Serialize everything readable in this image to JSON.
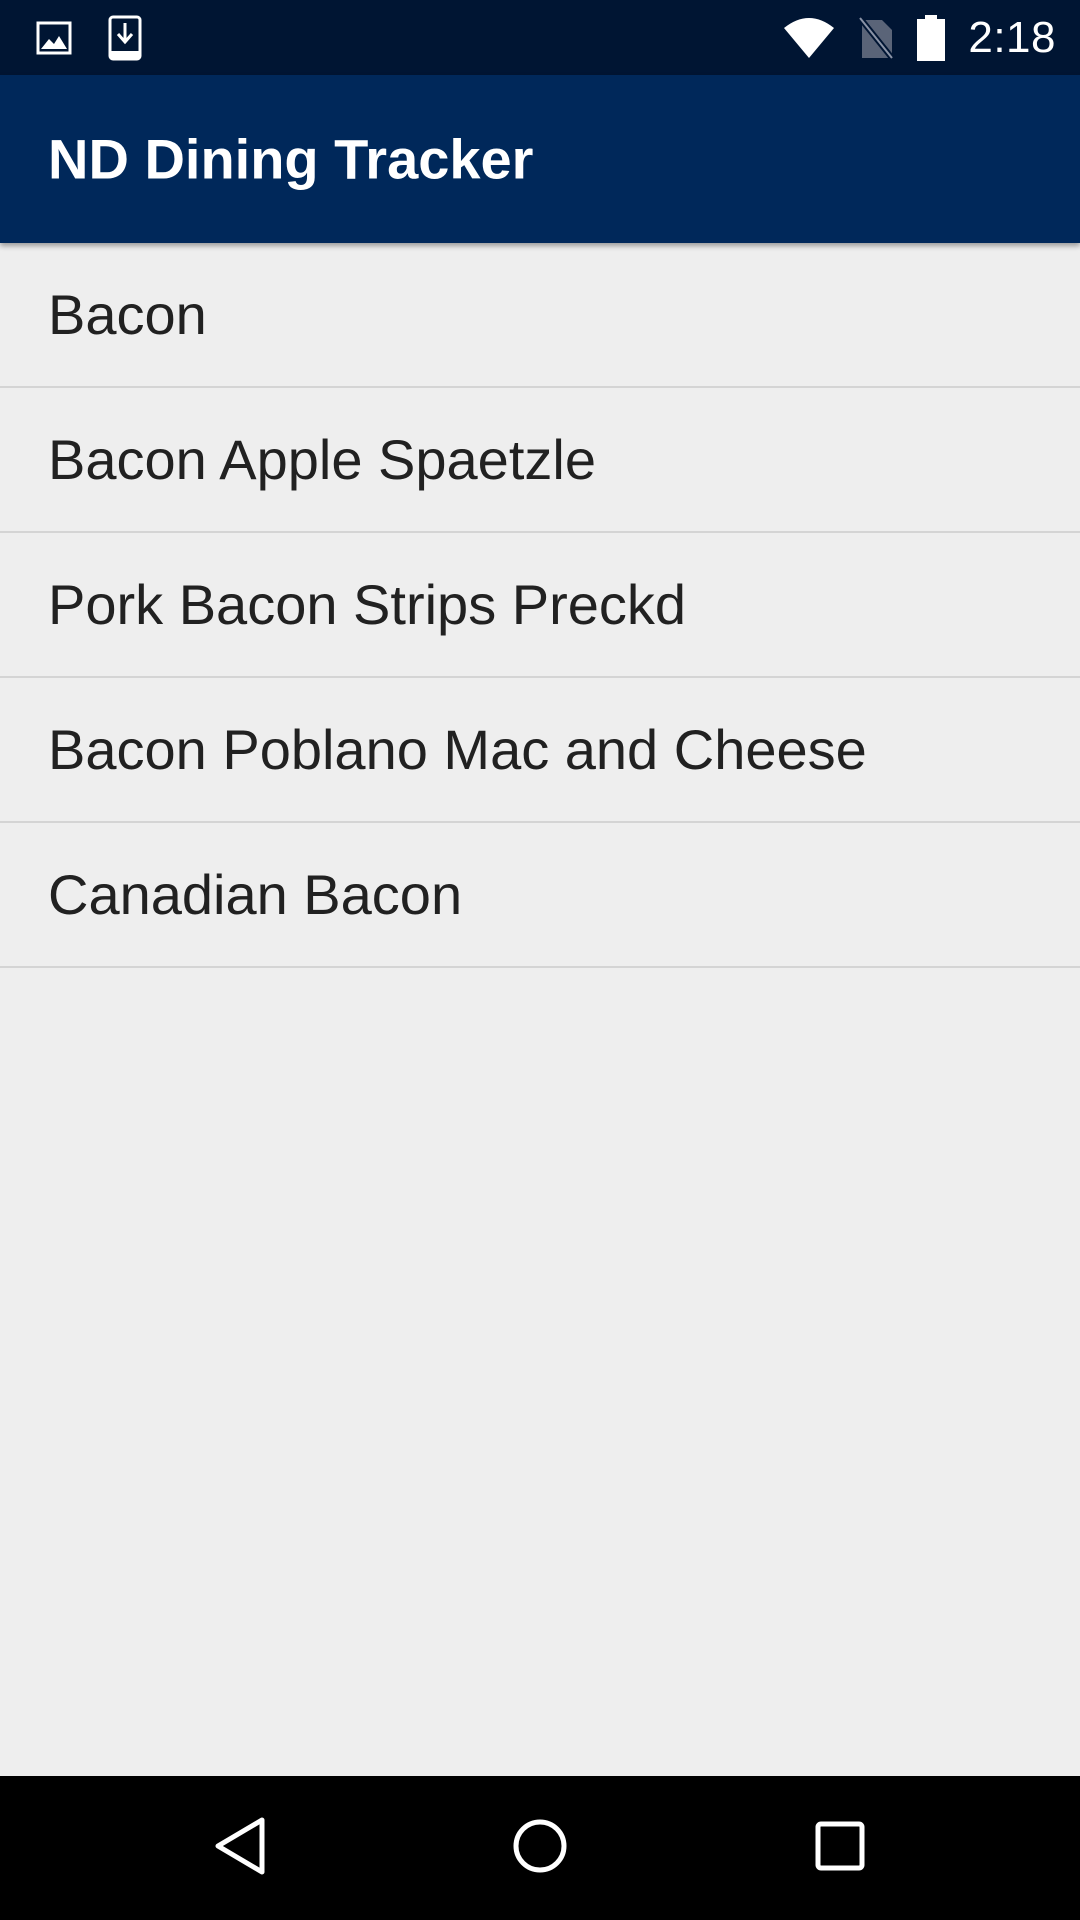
{
  "status_bar": {
    "time": "2:18",
    "left_icons": [
      "image-notification-icon",
      "download-notification-icon"
    ],
    "right_icons": [
      "wifi-icon",
      "no-sim-icon",
      "battery-icon"
    ],
    "background": "#001533"
  },
  "app_bar": {
    "title": "ND Dining Tracker",
    "background": "#00285a"
  },
  "list": {
    "items": [
      {
        "label": "Bacon"
      },
      {
        "label": "Bacon Apple Spaetzle"
      },
      {
        "label": "Pork Bacon Strips Preckd"
      },
      {
        "label": "Bacon Poblano Mac and Cheese"
      },
      {
        "label": "Canadian Bacon"
      }
    ]
  },
  "nav_bar": {
    "buttons": [
      "back-icon",
      "home-icon",
      "recents-icon"
    ],
    "background": "#000000"
  }
}
